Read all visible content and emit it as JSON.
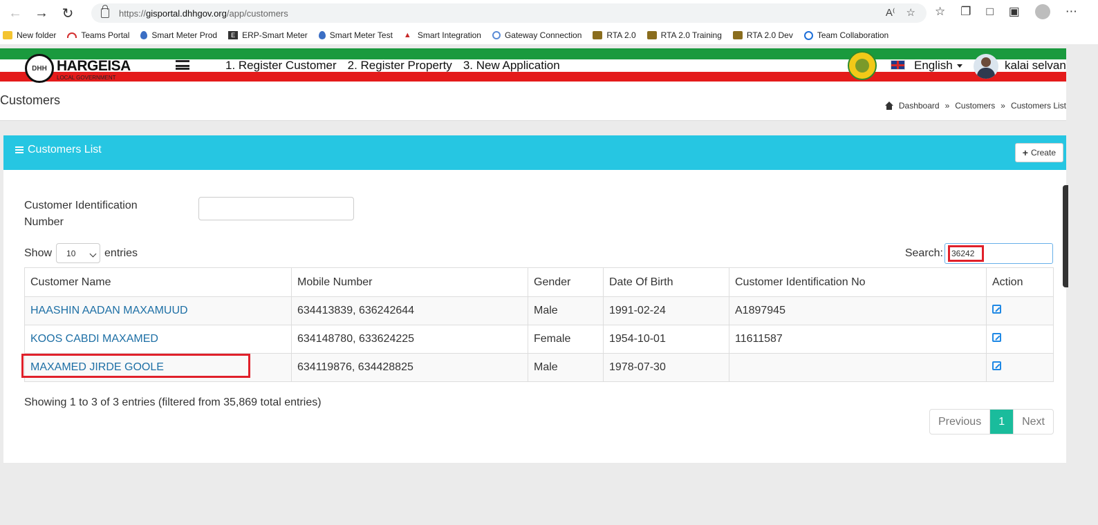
{
  "browser": {
    "url_proto": "https://",
    "url_host": "gisportal.dhhgov.org",
    "url_path": "/app/customers"
  },
  "bookmarks": [
    {
      "label": "New folder",
      "icon": "folder-icon"
    },
    {
      "label": "Teams Portal",
      "icon": "teams-icon"
    },
    {
      "label": "Smart Meter Prod",
      "icon": "drop-icon"
    },
    {
      "label": "ERP-Smart Meter",
      "icon": "erp-icon"
    },
    {
      "label": "Smart Meter Test",
      "icon": "drop-icon"
    },
    {
      "label": "Smart Integration",
      "icon": "integration-icon"
    },
    {
      "label": "Gateway Connection",
      "icon": "gateway-icon"
    },
    {
      "label": "RTA 2.0",
      "icon": "rta-icon"
    },
    {
      "label": "RTA 2.0 Training",
      "icon": "rta-icon"
    },
    {
      "label": "RTA 2.0 Dev",
      "icon": "rta-icon"
    },
    {
      "label": "Team Collaboration",
      "icon": "collaboration-icon"
    }
  ],
  "header": {
    "logo_text": "HARGEISA",
    "logo_sub": "LOCAL GOVERNMENT",
    "logo_mark": "DHH",
    "links": [
      "1. Register Customer",
      "2. Register Property",
      "3. New Application"
    ],
    "language": "English",
    "username": "kalai selvan"
  },
  "page": {
    "title": "Customers",
    "breadcrumb": [
      "Dashboard",
      "Customers",
      "Customers List"
    ],
    "breadcrumb_sep": "»"
  },
  "card": {
    "title": "Customers List",
    "create_label": "Create",
    "cin_label": "Customer Identification Number",
    "show_label": "Show",
    "entries_label": "entries",
    "page_length": "10",
    "search_label": "Search:",
    "search_value": "36242",
    "columns": [
      "Customer Name",
      "Mobile Number",
      "Gender",
      "Date Of Birth",
      "Customer Identification No",
      "Action"
    ],
    "rows": [
      {
        "name": "HAASHIN AADAN MAXAMUUD",
        "mobile": "634413839, 636242644",
        "gender": "Male",
        "dob": "1991-02-24",
        "cin": "A1897945"
      },
      {
        "name": "KOOS CABDI MAXAMED",
        "mobile": "634148780, 633624225",
        "gender": "Female",
        "dob": "1954-10-01",
        "cin": "11611587"
      },
      {
        "name": "MAXAMED JIRDE GOOLE",
        "mobile": "634119876, 634428825",
        "gender": "Male",
        "dob": "1978-07-30",
        "cin": ""
      }
    ],
    "info": "Showing 1 to 3 of 3 entries (filtered from 35,869 total entries)",
    "pager": {
      "previous": "Previous",
      "current": "1",
      "next": "Next"
    }
  },
  "colors": {
    "accent": "#26c6e2",
    "pager_active": "#1abc9c",
    "highlight": "#e0202a",
    "link": "#1d6fa5"
  }
}
